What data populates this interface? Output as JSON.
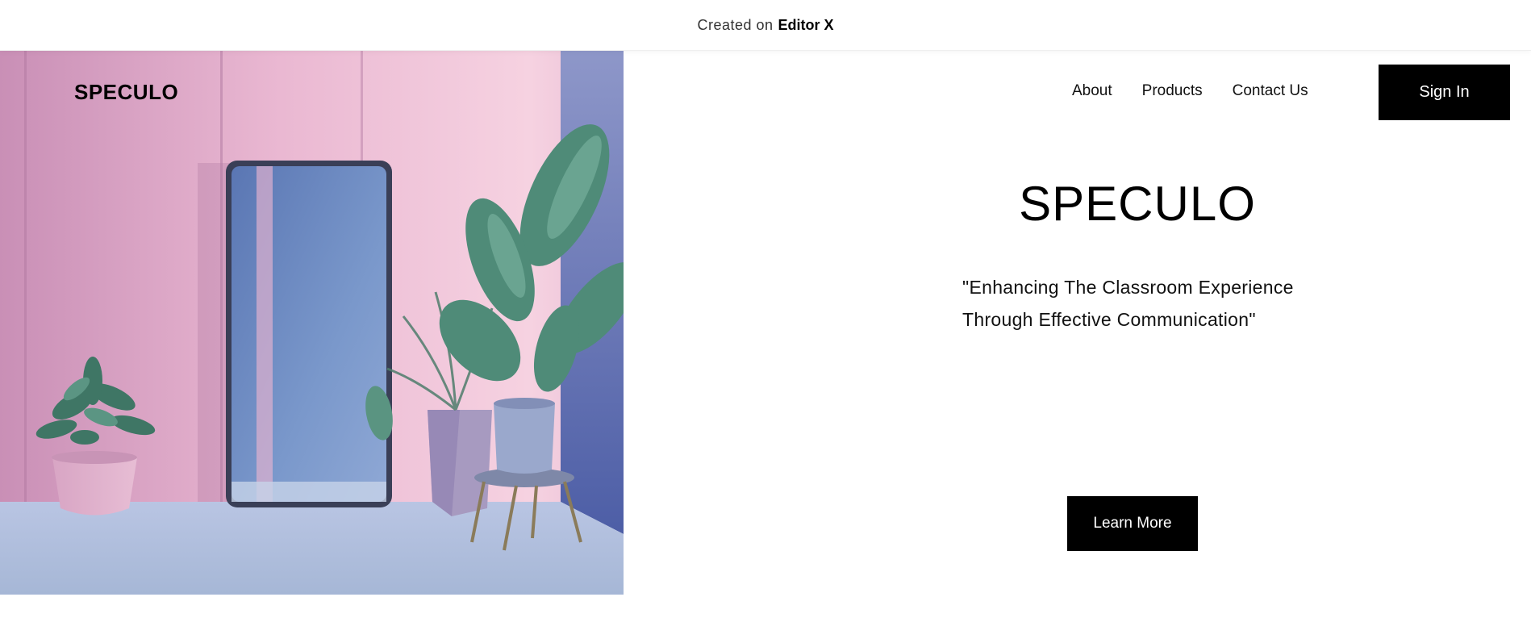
{
  "banner": {
    "prefix": "Created on",
    "brand": "Editor X"
  },
  "site": {
    "logo": "SPECULO"
  },
  "nav": {
    "items": [
      "About",
      "Products",
      "Contact Us"
    ],
    "sign_in": "Sign In"
  },
  "hero": {
    "title": "SPECULO",
    "quote_line1": "\"Enhancing The Classroom Experience",
    "quote_line2": "Through Effective Communication\"",
    "cta": "Learn More",
    "image_alt": "pink room with mirror and plants"
  },
  "colors": {
    "button_bg": "#000000",
    "button_text": "#ffffff",
    "page_bg": "#ffffff",
    "wall_pink": "#e7b3cf",
    "mirror_blue": "#6f8fc4",
    "floor_blue": "#b6c8e0"
  }
}
